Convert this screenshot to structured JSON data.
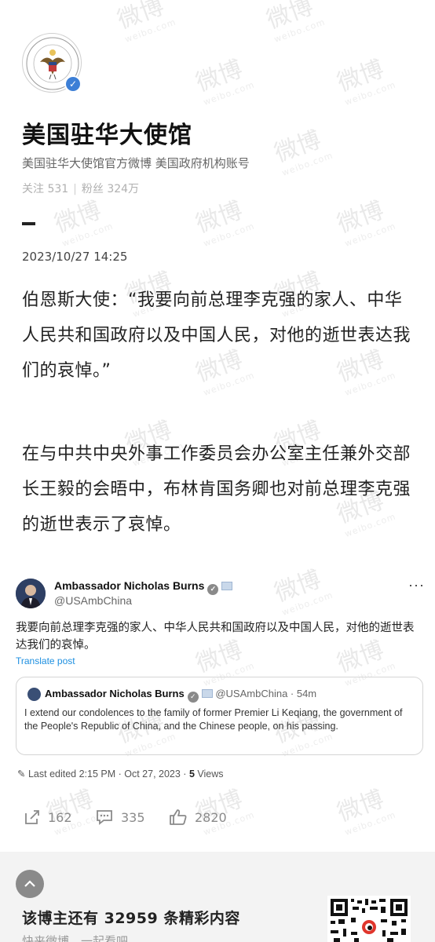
{
  "watermark": {
    "text": "微博",
    "sub": "weibo.com"
  },
  "account": {
    "name": "美国驻华大使馆",
    "description": "美国驻华大使馆官方微博 美国政府机构账号",
    "following_label": "关注 531",
    "followers_label": "粉丝 324万",
    "verified_icon": "verified-check-icon"
  },
  "post": {
    "timestamp": "2023/10/27 14:25",
    "paragraph1": "伯恩斯大使：“我要向前总理李克强的家人、中华人民共和国政府以及中国人民，对他的逝世表达我们的哀悼。”",
    "paragraph2": "在与中共中央外事工作委员会办公室主任兼外交部长王毅的会晤中，布林肯国务卿也对前总理李克强的逝世表示了哀悼。"
  },
  "embedded_tweet": {
    "author": "Ambassador Nicholas Burns",
    "handle": "@USAmbChina",
    "more_label": "···",
    "text": "我要向前总理李克强的家人、中华人民共和国政府以及中国人民，对他的逝世表达我们的哀悼。",
    "translate_label": "Translate post",
    "quoted": {
      "author": "Ambassador Nicholas Burns",
      "handle_time": "@USAmbChina · 54m",
      "text": "I extend our condolences to the family of former Premier Li Keqiang, the government of the People's Republic of China, and the Chinese people, on his passing."
    },
    "edited_label": "Last edited 2:15 PM · Oct 27, 2023 · ",
    "views_count": "5",
    "views_label": " Views"
  },
  "actions": {
    "repost_count": "162",
    "comment_count": "335",
    "like_count": "2820"
  },
  "footer": {
    "more_content_title": "该博主还有 32959 条精彩内容",
    "more_content_sub": "快来微博，一起看吧"
  }
}
